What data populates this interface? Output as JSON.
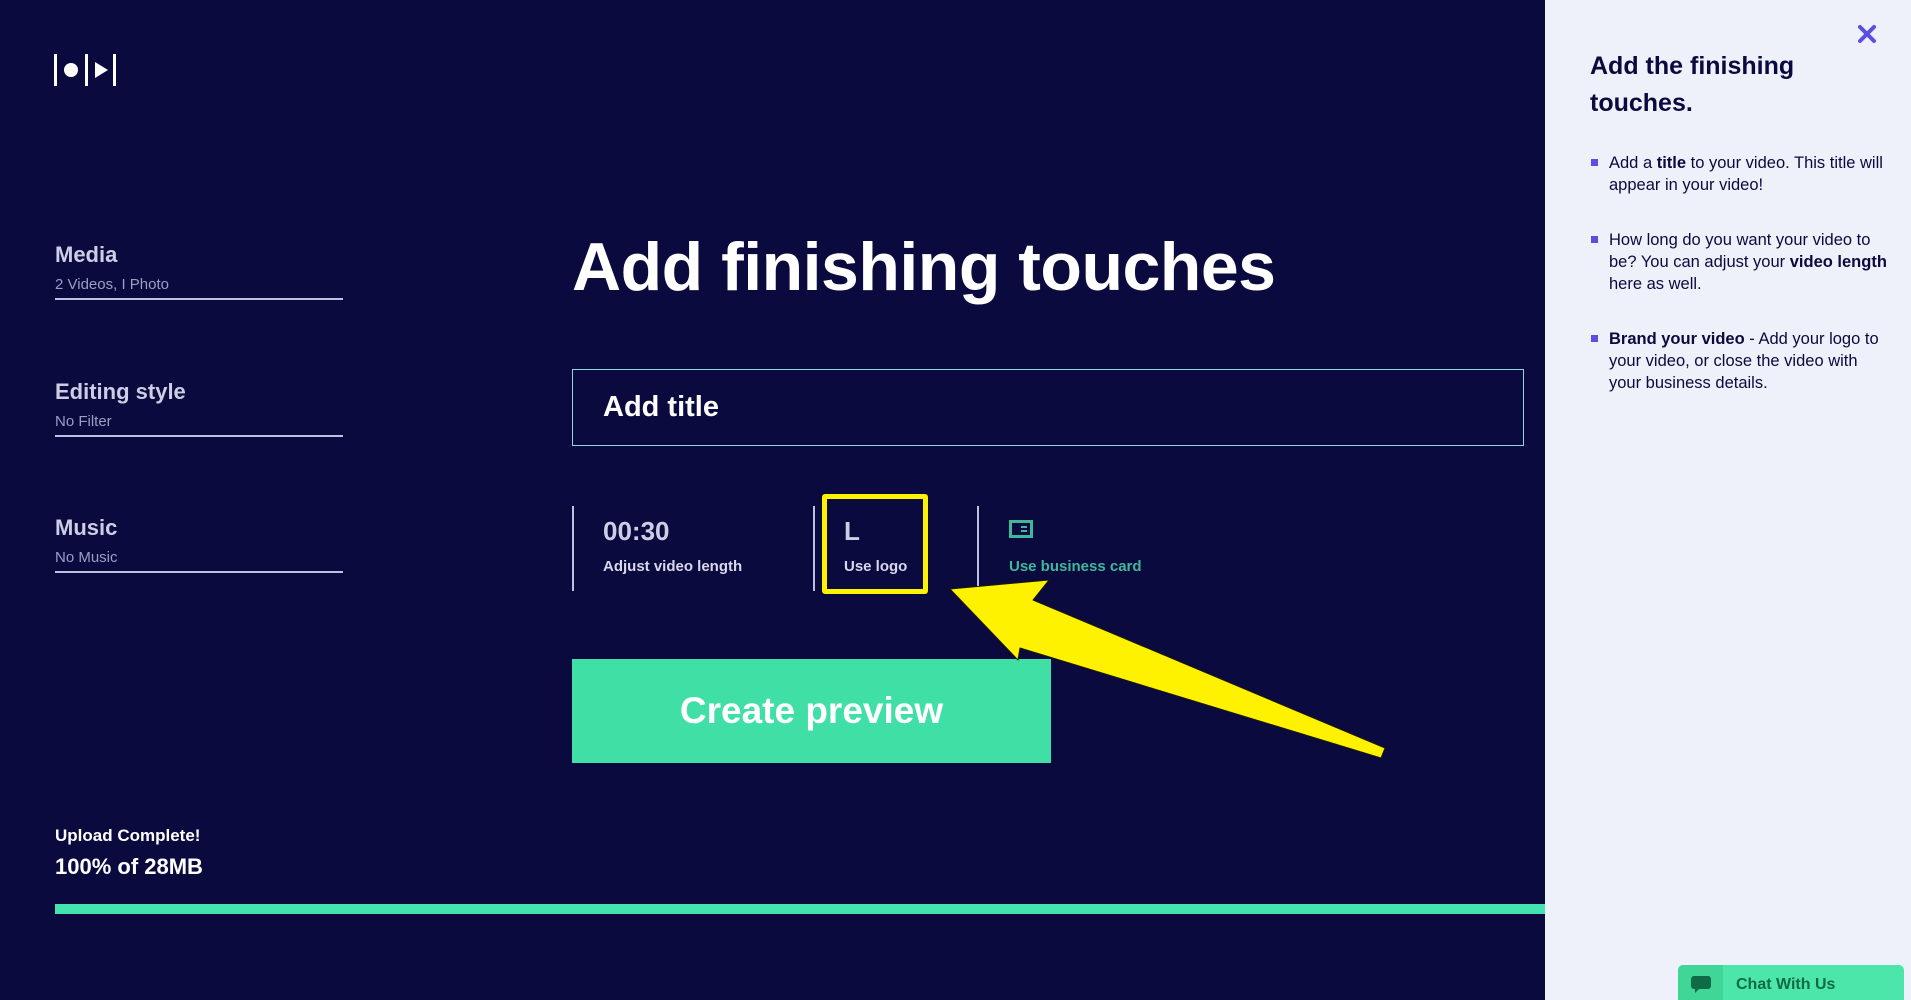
{
  "app": {
    "logo_icon": "record-play-logo-icon"
  },
  "steps": [
    {
      "title": "Media",
      "subtitle": "2 Videos, I Photo"
    },
    {
      "title": "Editing style",
      "subtitle": "No Filter"
    },
    {
      "title": "Music",
      "subtitle": "No Music"
    }
  ],
  "main": {
    "heading": "Add finishing touches",
    "title_input": {
      "placeholder": "Add title",
      "value": ""
    },
    "options": {
      "length": {
        "value": "00:30",
        "label": "Adjust video length"
      },
      "logo": {
        "value": "L",
        "label": "Use logo"
      },
      "business_card": {
        "icon": "business-card-icon",
        "label": "Use business card"
      }
    },
    "create_button": "Create preview"
  },
  "upload": {
    "status": "Upload Complete!",
    "amount": "100% of 28MB",
    "progress_percent": 100
  },
  "panel": {
    "title": "Add the finishing touches.",
    "close_icon": "close-icon",
    "tips": [
      {
        "parts": [
          [
            "Add a ",
            false
          ],
          [
            "title",
            true
          ],
          [
            " to your video. This title will appear in your video!",
            false
          ]
        ]
      },
      {
        "parts": [
          [
            "How long do you want your video to be? You can adjust your ",
            false
          ],
          [
            "video length",
            true
          ],
          [
            " here as well.",
            false
          ]
        ]
      },
      {
        "parts": [
          [
            "Brand your video",
            true
          ],
          [
            " - Add your logo to your video, or close the video with your business details.",
            false
          ]
        ]
      }
    ]
  },
  "chat": {
    "label": "Chat With Us",
    "icon": "chat-bubble-icon"
  },
  "colors": {
    "background": "#0b0a3e",
    "accent_green": "#40dfa6",
    "panel_bg": "#eef0fa",
    "bullet_purple": "#5b4fe0",
    "annotation_yellow": "#fff200"
  }
}
